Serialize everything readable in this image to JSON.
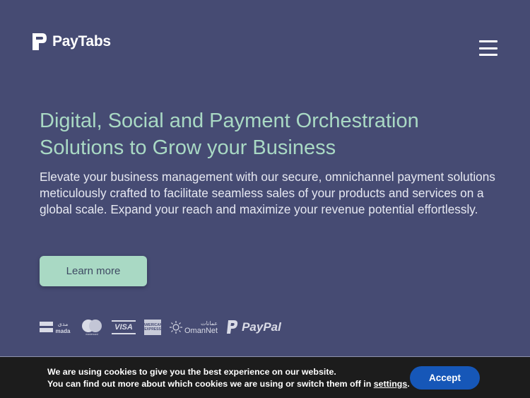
{
  "header": {
    "brand": "PayTabs",
    "menu_icon": "hamburger-menu-icon"
  },
  "hero": {
    "title": "Digital, Social and Payment Orchestration Solutions to Grow your Business",
    "description": "Elevate your business management with our secure, omnichannel payment solutions meticulously crafted to facilitate seamless sales of your products and services on a global scale. Expand your reach and maximize your revenue potential effortlessly.",
    "cta_label": "Learn more"
  },
  "payment_logos": {
    "mada_ar": "مدى",
    "mada": "mada",
    "mastercard": "mastercard",
    "visa": "VISA",
    "amex": "AMERICAN EXPRESS",
    "omannet_ar": "عمانات",
    "omannet": "OmanNet",
    "paypal": "PayPal"
  },
  "cookie": {
    "line1": "We are using cookies to give you the best experience on our website.",
    "line2_prefix": "You can find out more about which cookies we are using or switch them off in ",
    "settings_link": "settings",
    "line2_suffix": ".",
    "accept_label": "Accept"
  },
  "colors": {
    "background": "#464b73",
    "accent": "#a9d9c4",
    "cookie_bar": "#1c1c1c",
    "accept_button": "#1657b8"
  }
}
